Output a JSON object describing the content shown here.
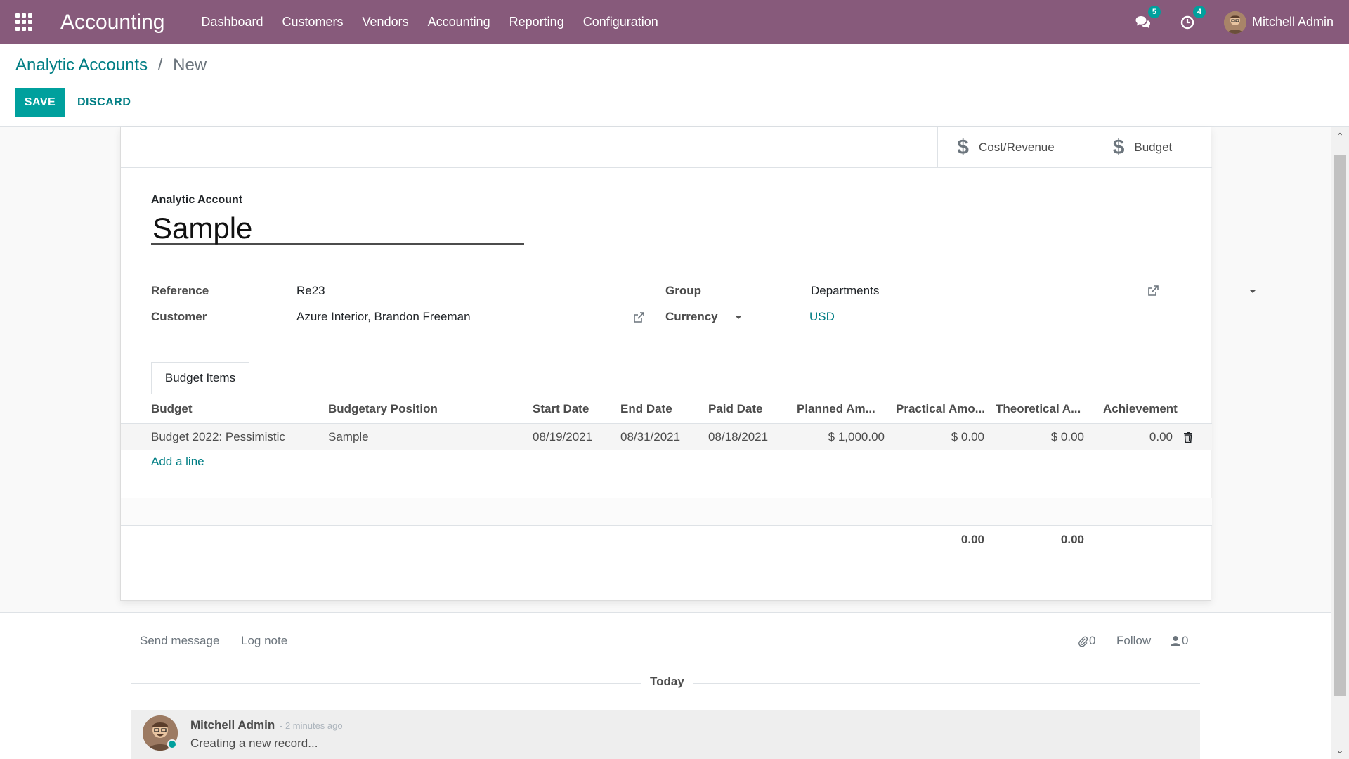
{
  "nav": {
    "app_name": "Accounting",
    "menu": [
      "Dashboard",
      "Customers",
      "Vendors",
      "Accounting",
      "Reporting",
      "Configuration"
    ],
    "messages_count": "5",
    "activities_count": "4",
    "user_name": "Mitchell Admin"
  },
  "breadcrumb": {
    "parent": "Analytic Accounts",
    "separator": "/",
    "current": "New"
  },
  "actions": {
    "save": "SAVE",
    "discard": "DISCARD"
  },
  "smart_buttons": {
    "cost_revenue": "Cost/Revenue",
    "budget": "Budget"
  },
  "form": {
    "analytic_account_label": "Analytic Account",
    "name": "Sample",
    "reference_label": "Reference",
    "reference_value": "Re23",
    "customer_label": "Customer",
    "customer_value": "Azure Interior, Brandon Freeman",
    "group_label": "Group",
    "group_value": "Departments",
    "currency_label": "Currency",
    "currency_value": "USD"
  },
  "tabs": {
    "budget_items": "Budget Items"
  },
  "table": {
    "columns": [
      "Budget",
      "Budgetary Position",
      "Start Date",
      "End Date",
      "Paid Date",
      "Planned Am...",
      "Practical Amo...",
      "Theoretical A...",
      "Achievement"
    ],
    "rows": [
      [
        "Budget 2022: Pessimistic",
        "Sample",
        "08/19/2021",
        "08/31/2021",
        "08/18/2021",
        "$ 1,000.00",
        "$ 0.00",
        "$ 0.00",
        "0.00"
      ]
    ],
    "add_line": "Add a line",
    "totals": {
      "practical": "0.00",
      "theoretical": "0.00"
    }
  },
  "chatter": {
    "send_message": "Send message",
    "log_note": "Log note",
    "attachments": "0",
    "follow": "Follow",
    "followers": "0",
    "today": "Today",
    "message": {
      "author": "Mitchell Admin",
      "time": "- 2 minutes ago",
      "body": "Creating a new record..."
    }
  },
  "colors": {
    "navbar": "#875a7b",
    "accent": "#00a09d",
    "link": "#017e84"
  }
}
